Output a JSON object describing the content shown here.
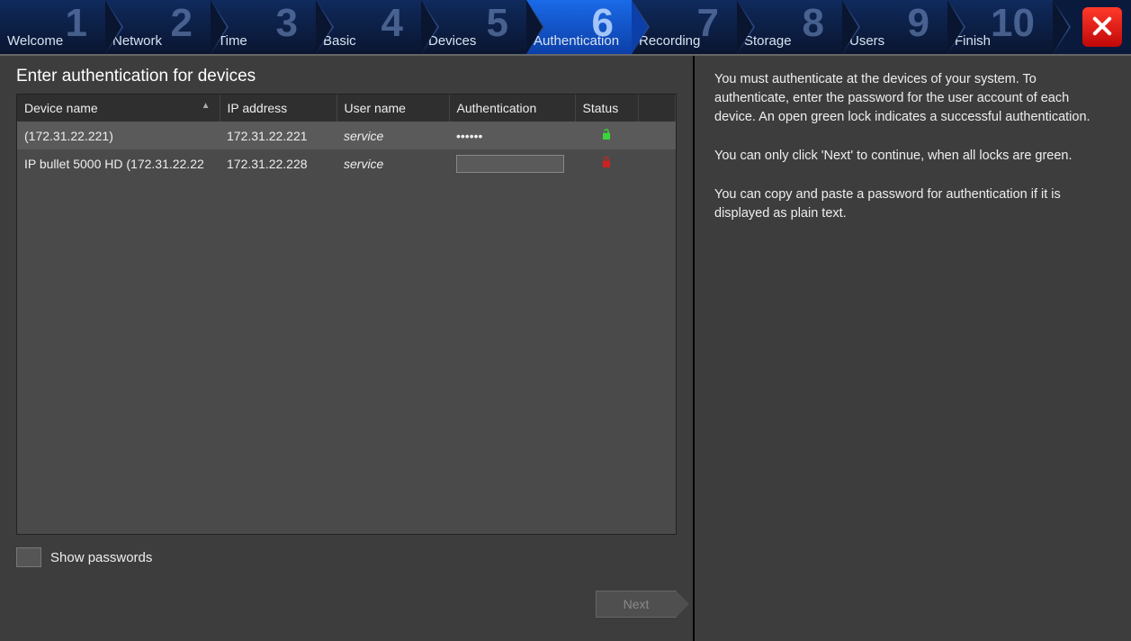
{
  "wizard": {
    "steps": [
      {
        "num": "1",
        "label": "Welcome"
      },
      {
        "num": "2",
        "label": "Network"
      },
      {
        "num": "3",
        "label": "Time"
      },
      {
        "num": "4",
        "label": "Basic"
      },
      {
        "num": "5",
        "label": "Devices"
      },
      {
        "num": "6",
        "label": "Authentication"
      },
      {
        "num": "7",
        "label": "Recording"
      },
      {
        "num": "8",
        "label": "Storage"
      },
      {
        "num": "9",
        "label": "Users"
      },
      {
        "num": "10",
        "label": "Finish"
      }
    ],
    "active_index": 5
  },
  "page": {
    "title": "Enter authentication for devices"
  },
  "table": {
    "headers": {
      "device": "Device name",
      "ip": "IP address",
      "user": "User name",
      "auth": "Authentication",
      "status": "Status"
    },
    "rows": [
      {
        "device": " (172.31.22.221)",
        "ip": "172.31.22.221",
        "user": "service",
        "auth": "••••••",
        "status": "open"
      },
      {
        "device": "IP bullet 5000 HD (172.31.22.22",
        "ip": "172.31.22.228",
        "user": "service",
        "auth": "",
        "status": "closed"
      }
    ]
  },
  "show_passwords_label": "Show passwords",
  "next_button_label": "Next",
  "help": {
    "p1": "You must authenticate at the devices of your system. To authenticate, enter the password for the user account of each device. An open green lock indicates a successful authentication.",
    "p2": "You can only click 'Next' to continue, when all locks are green.",
    "p3": "You can copy and paste a password for authentication if it is displayed as plain text."
  },
  "colors": {
    "accent": "#1a6ae8",
    "lock_open": "#3ad63a",
    "lock_closed": "#cc2222"
  }
}
